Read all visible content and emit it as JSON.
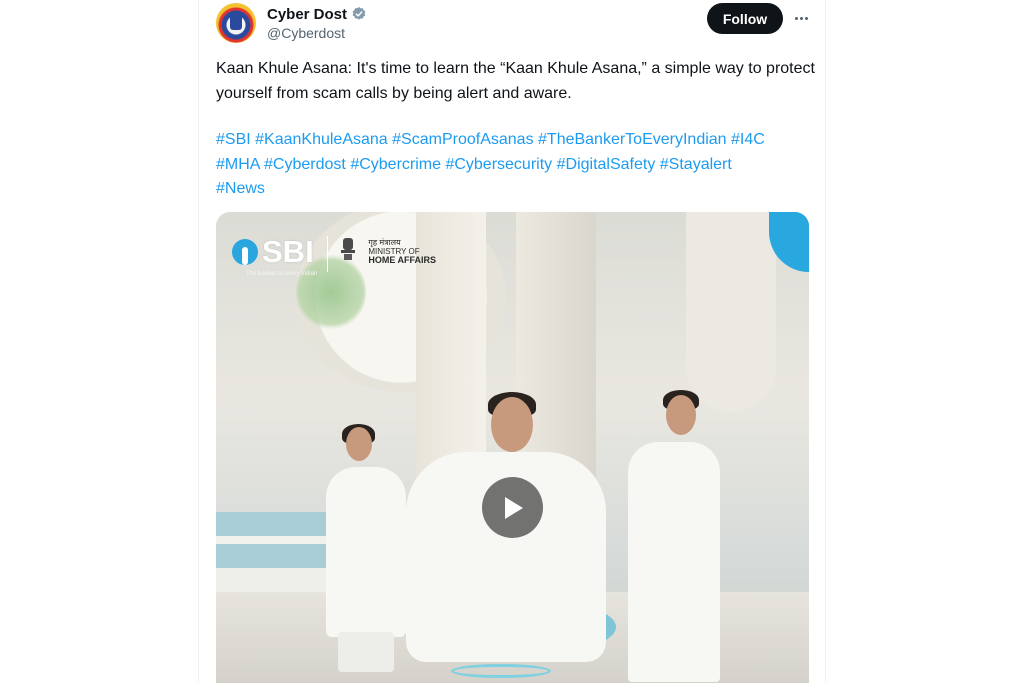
{
  "account": {
    "display_name": "Cyber Dost",
    "handle": "@Cyberdost"
  },
  "actions": {
    "follow_label": "Follow"
  },
  "tweet": {
    "text": "Kaan Khule Asana: It's time to learn the “Kaan Khule Asana,” a simple way to protect yourself from scam calls by being alert and aware.",
    "hashtags": [
      "#SBI",
      "#KaanKhuleAsana",
      "#ScamProofAsanas",
      "#TheBankerToEveryIndian",
      "#I4C",
      "#MHA",
      "#Cyberdost",
      "#Cybercrime",
      "#Cybersecurity",
      "#DigitalSafety",
      "#Stayalert",
      "#News"
    ]
  },
  "video": {
    "sbi_logo_text": "SBI",
    "sbi_tagline": "The banker to every Indian",
    "ministry_hindi": "गृह मंत्रालय",
    "ministry_line1": "MINISTRY OF",
    "ministry_line2": "HOME AFFAIRS"
  },
  "colors": {
    "link": "#1d9bf0",
    "follow_bg": "#0f1419",
    "verified": "#829aab",
    "sbi_blue": "#2aa6df"
  }
}
